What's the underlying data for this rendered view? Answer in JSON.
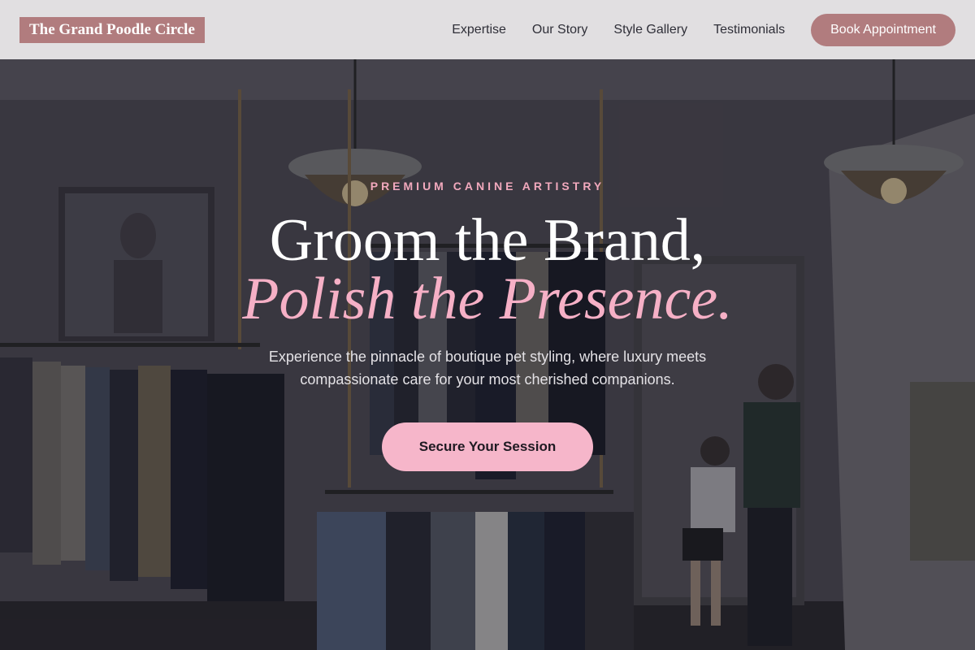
{
  "header": {
    "brand": "The Grand Poodle Circle",
    "nav": [
      {
        "label": "Expertise"
      },
      {
        "label": "Our Story"
      },
      {
        "label": "Style Gallery"
      },
      {
        "label": "Testimonials"
      }
    ],
    "cta_label": "Book Appointment"
  },
  "hero": {
    "eyebrow": "PREMIUM CANINE ARTISTRY",
    "headline_line1": "Groom the Brand,",
    "headline_line2": "Polish the Presence.",
    "subtext": "Experience the pinnacle of boutique pet styling, where luxury meets compassionate care for your most cherished companions.",
    "cta_label": "Secure Your Session"
  },
  "colors": {
    "brand_accent": "#b17c7e",
    "pink_accent": "#f6b6ca",
    "nav_background": "#e8e6e8"
  }
}
